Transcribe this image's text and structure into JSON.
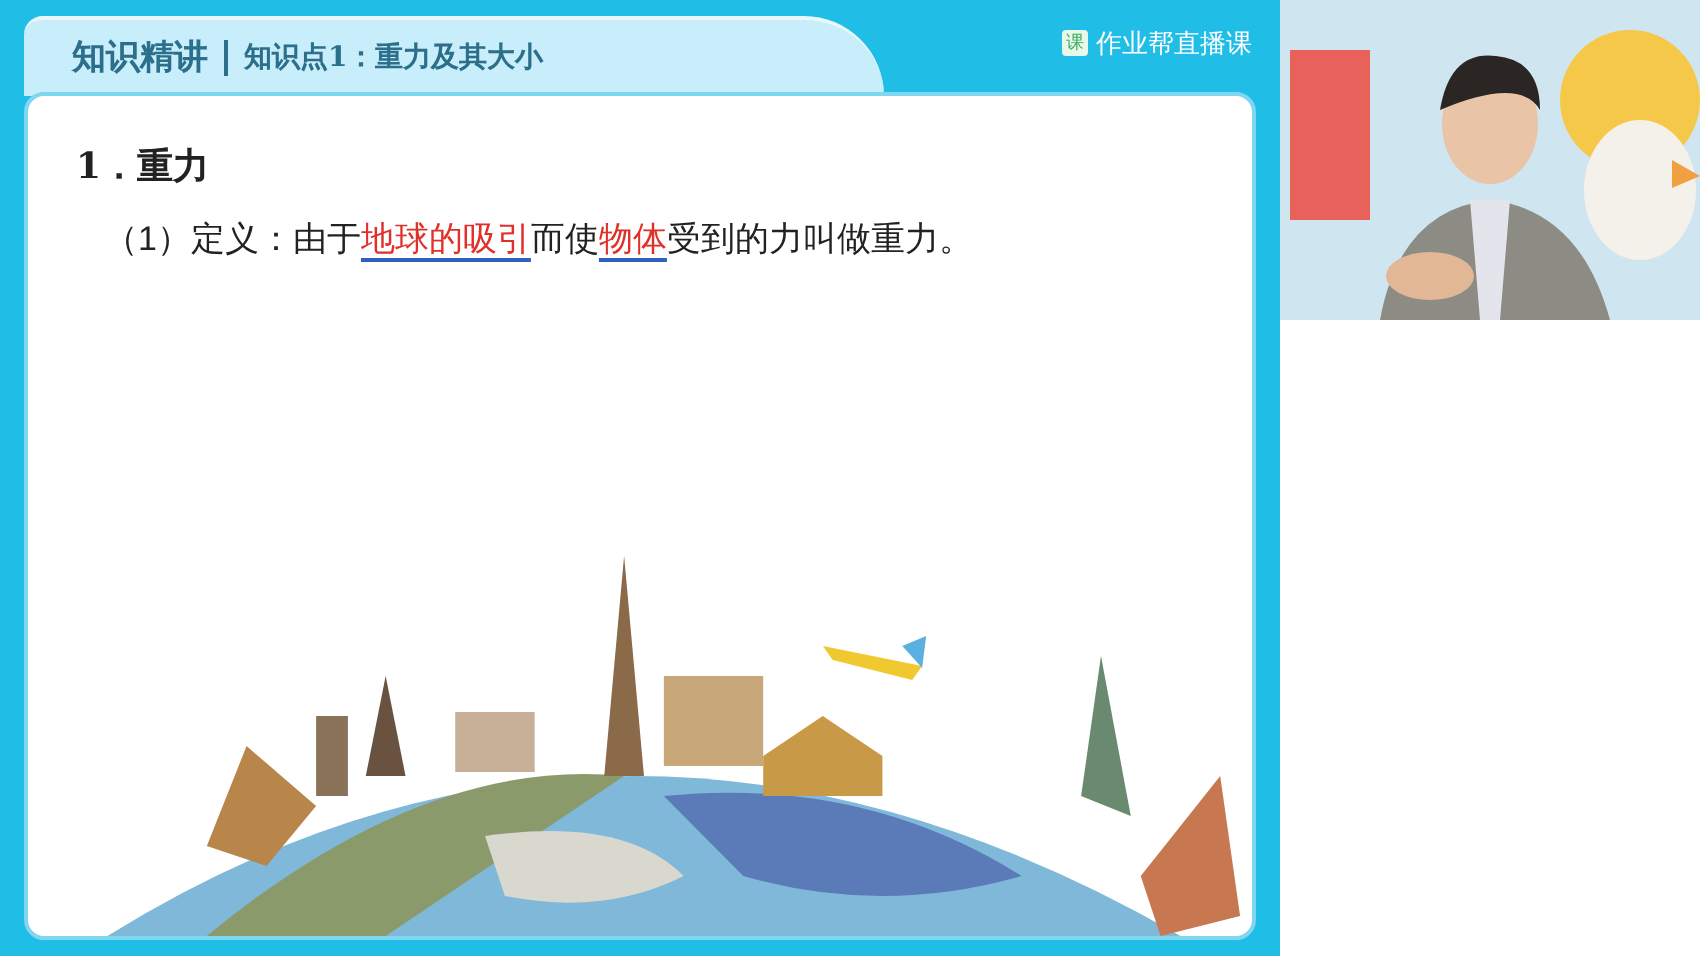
{
  "header": {
    "section": "知识精讲",
    "topic": "知识点1：重力及其大小"
  },
  "logo": {
    "badge": "课",
    "name": "作业帮直播课"
  },
  "slide": {
    "heading": "1．重力",
    "definition": [
      {
        "text": "（1）定义：由于",
        "highlighted": false
      },
      {
        "text": "地球的吸引",
        "highlighted": true
      },
      {
        "text": "而使",
        "highlighted": false
      },
      {
        "text": "物体",
        "highlighted": true
      },
      {
        "text": "受到的力叫做重力。",
        "highlighted": false
      }
    ]
  }
}
